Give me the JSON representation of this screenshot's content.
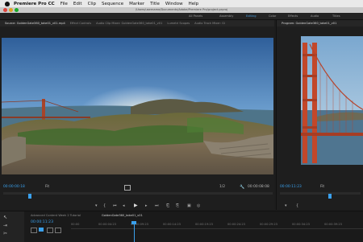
{
  "menubar": {
    "app": "Premiere Pro CC",
    "items": [
      "File",
      "Edit",
      "Clip",
      "Sequence",
      "Marker",
      "Title",
      "Window",
      "Help"
    ]
  },
  "titlebar": {
    "text": "/Users/username/Documents/Adobe/Premiere Pro/project.prproj"
  },
  "workspaces": {
    "tabs": [
      "All Panels",
      "Assembly",
      "Editing",
      "Color",
      "Effects",
      "Audio",
      "Titles"
    ],
    "active": "Editing"
  },
  "source_panel": {
    "tabs": [
      "Source: GoldenGate360_take01_v01.mp4",
      "Effect Controls",
      "Audio Clip Mixer: GoldenGate360_take01_v01",
      "Lumetri Scopes",
      "Audio Track Mixer: Gi"
    ],
    "timecode_in": "00:00:00:18",
    "zoom": "Fit",
    "resolution": "1/2",
    "timecode_out": "00:00:08:08"
  },
  "program_panel": {
    "tab": "Program: GoldenGate360_take01_v01",
    "timecode": "00:00:11:23",
    "zoom": "Fit"
  },
  "timeline": {
    "tabs": [
      "Advanced Content Week 2 Tutorial",
      "GoldenGate360_take01_v01"
    ],
    "timecode": "00:00:11:23",
    "ruler": [
      "00:00",
      "00:00:04:23",
      "00:00:09:23",
      "00:00:14:23",
      "00:00:19:23",
      "00:00:24:23",
      "00:00:29:23",
      "00:00:34:23",
      "00:00:39:23",
      "00:00:44:23"
    ]
  },
  "colors": {
    "accent": "#3aa0ec",
    "menubar": "#e9e9e9",
    "panel": "#1e1e1e"
  }
}
